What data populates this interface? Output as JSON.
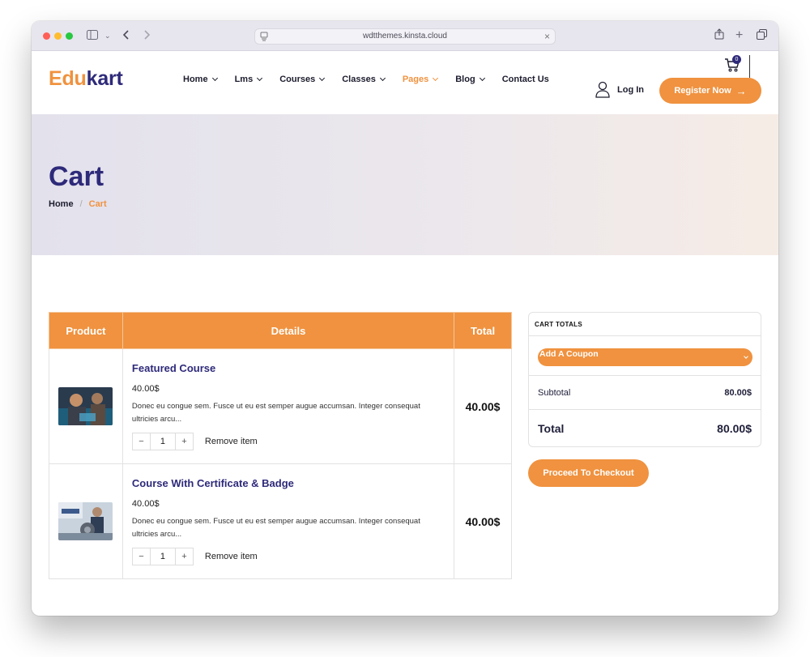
{
  "browser": {
    "url": "wdtthemes.kinsta.cloud"
  },
  "header": {
    "logo_part1": "Edu",
    "logo_part2": "kart",
    "nav": [
      {
        "label": "Home",
        "has_dropdown": true
      },
      {
        "label": "Lms",
        "has_dropdown": true
      },
      {
        "label": "Courses",
        "has_dropdown": true
      },
      {
        "label": "Classes",
        "has_dropdown": true
      },
      {
        "label": "Pages",
        "has_dropdown": true,
        "active": true
      },
      {
        "label": "Blog",
        "has_dropdown": true
      },
      {
        "label": "Contact Us",
        "has_dropdown": false
      }
    ],
    "cart_count": "0",
    "login_label": "Log In",
    "register_label": "Register Now"
  },
  "hero": {
    "title": "Cart",
    "breadcrumb": {
      "home": "Home",
      "separator": "/",
      "current": "Cart"
    }
  },
  "cart": {
    "columns": [
      "Product",
      "Details",
      "Total"
    ],
    "items": [
      {
        "title": "Featured Course",
        "price": "40.00$",
        "description": "Donec eu congue sem. Fusce ut eu est semper augue accumsan. Integer consequat ultricies arcu...",
        "quantity": "1",
        "remove_label": "Remove item",
        "total": "40.00$",
        "qty_minus": "−",
        "qty_plus": "+"
      },
      {
        "title": "Course With Certificate & Badge",
        "price": "40.00$",
        "description": "Donec eu congue sem. Fusce ut eu est semper augue accumsan. Integer consequat ultricies arcu...",
        "quantity": "1",
        "remove_label": "Remove item",
        "total": "40.00$",
        "qty_minus": "−",
        "qty_plus": "+"
      }
    ]
  },
  "totals": {
    "heading": "CART TOTALS",
    "coupon_label": "Add A Coupon",
    "subtotal_label": "Subtotal",
    "subtotal_value": "80.00$",
    "total_label": "Total",
    "total_value": "80.00$",
    "checkout_label": "Proceed To Checkout"
  },
  "colors": {
    "accent": "#f0923f",
    "brand_dark": "#2e2a7a"
  }
}
